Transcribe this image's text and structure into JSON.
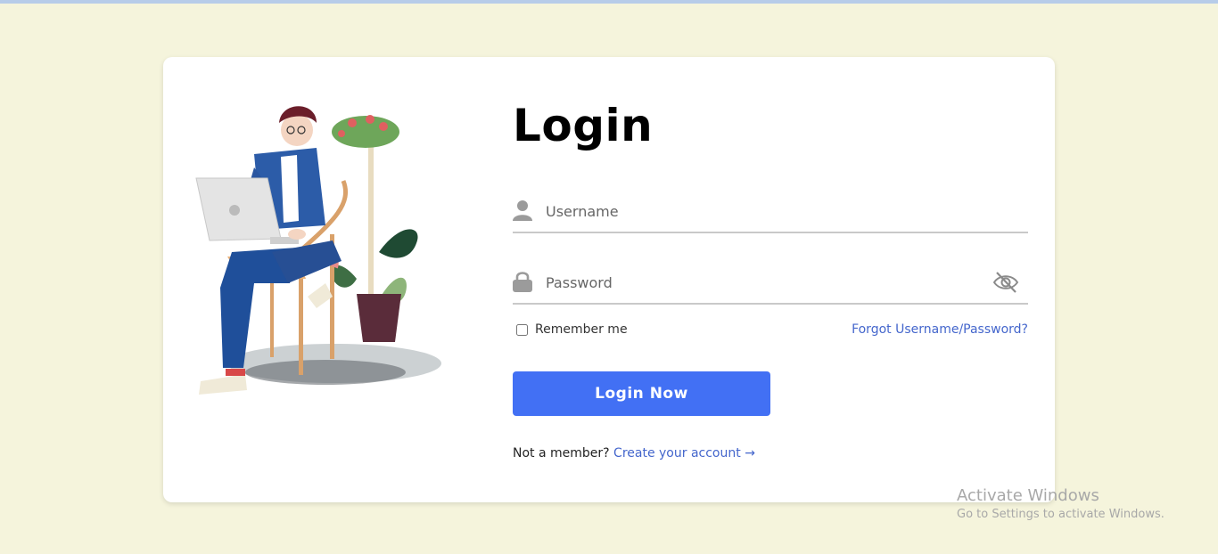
{
  "login": {
    "title": "Login",
    "username_placeholder": "Username",
    "password_placeholder": "Password",
    "remember_label": "Remember me",
    "remember_checked": false,
    "forgot_link": "Forgot Username/Password?",
    "submit_label": "Login Now",
    "member_text": "Not a member?",
    "create_link": "Create your account",
    "create_arrow": "→"
  },
  "watermark": {
    "line1": "Activate Windows",
    "line2": "Go to Settings to activate Windows."
  },
  "icons": {
    "username": "user-icon",
    "password": "lock-icon",
    "toggle": "eye-slash-icon"
  },
  "colors": {
    "background": "#f5f4dc",
    "card": "#ffffff",
    "primary_button": "#4270f4",
    "link": "#4466cc"
  }
}
